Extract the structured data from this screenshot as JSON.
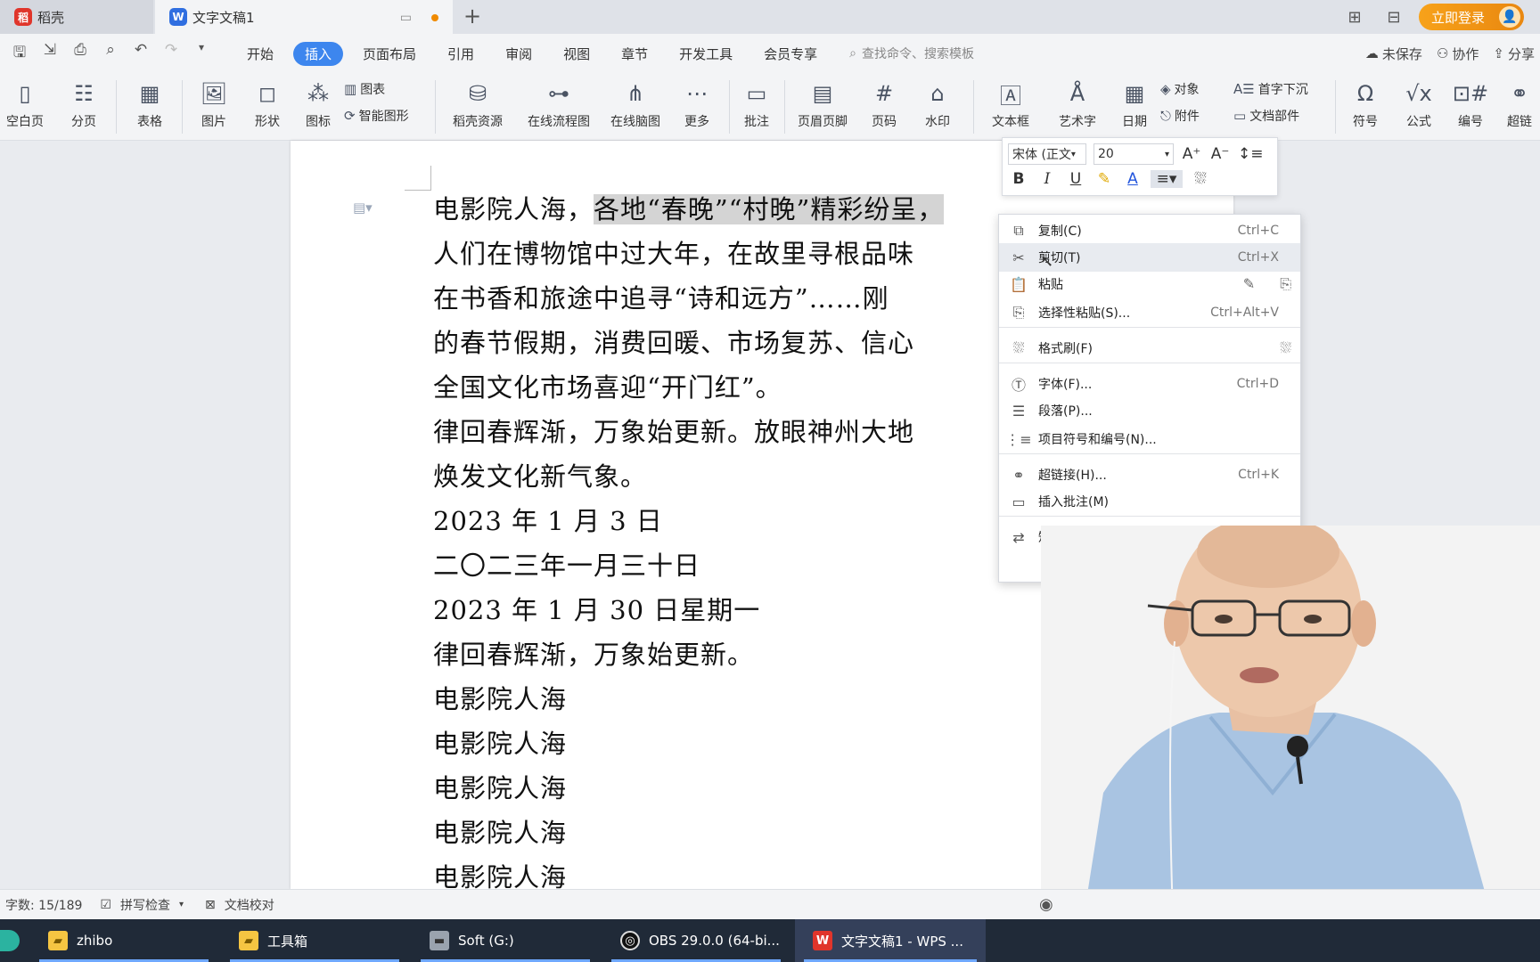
{
  "titlebar": {
    "tabs": [
      {
        "label": "稻壳",
        "icon": "docer-logo-icon"
      },
      {
        "label": "文字文稿1",
        "icon": "wps-writer-icon"
      }
    ],
    "new_tab": "+",
    "login_label": "立即登录"
  },
  "menubar": {
    "items": [
      "开始",
      "插入",
      "页面布局",
      "引用",
      "审阅",
      "视图",
      "章节",
      "开发工具",
      "会员专享"
    ],
    "active": "插入",
    "search_placeholder": "查找命令、搜索模板",
    "right": {
      "unsaved": "未保存",
      "collab": "协作",
      "share": "分享"
    }
  },
  "ribbon": {
    "blank_page": "空白页",
    "page_break": "分页",
    "table": "表格",
    "picture": "图片",
    "shape": "形状",
    "icon": "图标",
    "chart": "图表",
    "smart_art": "智能图形",
    "docer_resource": "稻壳资源",
    "online_flowchart": "在线流程图",
    "online_mindmap": "在线脑图",
    "more": "更多",
    "comment": "批注",
    "header_footer": "页眉页脚",
    "page_number": "页码",
    "watermark": "水印",
    "textbox": "文本框",
    "wordart": "艺术字",
    "date": "日期",
    "object": "对象",
    "attachment": "附件",
    "drop_cap": "首字下沉",
    "doc_parts": "文档部件",
    "symbol": "符号",
    "formula": "公式",
    "numbering": "编号",
    "hyperlink": "超链"
  },
  "document": {
    "lines": [
      {
        "pre": "电影院人海，",
        "hl": "各地“春晚”“村晚”精彩纷呈，"
      },
      {
        "pre": "人们在博物馆中过大年，在故里寻根品味"
      },
      {
        "pre": "在书香和旅途中追寻“诗和远方”……刚"
      },
      {
        "pre": "的春节假期，消费回暖、市场复苏、信心"
      },
      {
        "pre": "全国文化市场喜迎“开门红”。"
      },
      {
        "pre": "律回春辉渐，万象始更新。放眼神州大地"
      },
      {
        "pre": "焕发文化新气象。"
      },
      {
        "pre": "2023 年 1 月 3 日"
      },
      {
        "pre": "二〇二三年一月三十日"
      },
      {
        "pre": "2023 年 1 月 30 日星期一"
      },
      {
        "pre": "律回春辉渐，万象始更新。"
      },
      {
        "pre": "电影院人海"
      },
      {
        "pre": "电影院人海"
      },
      {
        "pre": "电影院人海"
      },
      {
        "pre": "电影院人海"
      },
      {
        "pre": "电影院人海"
      }
    ]
  },
  "mini_toolbar": {
    "font": "宋体 (正文",
    "size": "20",
    "bold": "B",
    "italic": "I",
    "underline": "U",
    "font_color_label": "A"
  },
  "context_menu": {
    "items": [
      {
        "label": "复制(C)",
        "shortcut": "Ctrl+C",
        "icon": "copy-icon"
      },
      {
        "label": "剪切(T)",
        "shortcut": "Ctrl+X",
        "icon": "cut-icon"
      },
      {
        "label": "粘贴",
        "shortcut": "",
        "icon": "paste-icon"
      },
      {
        "label": "选择性粘贴(S)...",
        "shortcut": "Ctrl+Alt+V",
        "icon": "paste-special-icon"
      },
      {
        "label": "格式刷(F)",
        "shortcut": "",
        "icon": "format-painter-icon"
      },
      {
        "label": "字体(F)...",
        "shortcut": "Ctrl+D",
        "icon": "font-icon"
      },
      {
        "label": "段落(P)...",
        "shortcut": "",
        "icon": "paragraph-icon"
      },
      {
        "label": "项目符号和编号(N)...",
        "shortcut": "",
        "icon": "bullets-icon"
      },
      {
        "label": "超链接(H)...",
        "shortcut": "Ctrl+K",
        "icon": "hyperlink-icon"
      },
      {
        "label": "插入批注(M)",
        "shortcut": "",
        "icon": "comment-icon"
      },
      {
        "label": "短句翻译(T)",
        "shortcut": "",
        "icon": "translate-icon"
      }
    ],
    "hovered": "剪切(T)"
  },
  "statusbar": {
    "word_count": "字数: 15/189",
    "spell_check": "拼写检查",
    "doc_proof": "文档校对"
  },
  "taskbar": {
    "items": [
      {
        "label": "zhibo",
        "icon": "folder-icon"
      },
      {
        "label": "工具箱",
        "icon": "folder-icon"
      },
      {
        "label": "Soft (G:)",
        "icon": "drive-icon"
      },
      {
        "label": "OBS 29.0.0 (64-bi...",
        "icon": "obs-icon"
      },
      {
        "label": "文字文稿1 - WPS ...",
        "icon": "wps-icon"
      }
    ]
  },
  "colors": {
    "accent": "#3d86ee",
    "login": "#f39a16",
    "taskbar": "#202a38",
    "highlight": "#d4d4d4"
  }
}
